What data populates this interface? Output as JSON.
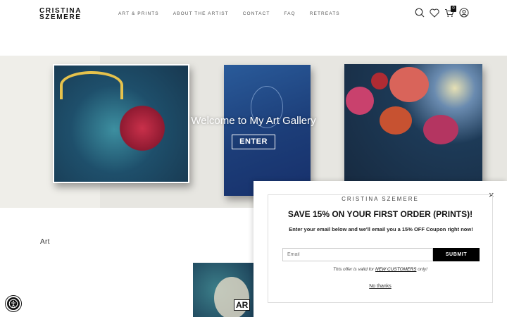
{
  "header": {
    "logo_line1": "CRISTINA",
    "logo_line2": "SZEMERE",
    "nav": [
      "ART & PRINTS",
      "ABOUT THE ARTIST",
      "CONTACT",
      "FAQ",
      "RETREATS"
    ],
    "cart_count": "0",
    "icons": [
      "search-icon",
      "heart-icon",
      "cart-icon",
      "user-icon"
    ]
  },
  "hero": {
    "title": "Welcome to My Art Gallery",
    "button_label": "ENTER"
  },
  "section": {
    "title": "Art",
    "thumb_badge": "AR"
  },
  "popup": {
    "brand": "CRISTINA SZEMERE",
    "headline": "SAVE 15% ON YOUR FIRST ORDER (PRINTS)!",
    "subtext": "Enter your email below and we'll email you a 15% OFF Coupon right now!",
    "email_placeholder": "Email",
    "submit_label": "SUBMIT",
    "offer_prefix": "This offer is valid for ",
    "offer_link": "NEW CUSTOMERS",
    "offer_suffix": " only!",
    "no_thanks": "No thanks",
    "close_symbol": "×"
  },
  "accessibility": {
    "icon": "accessibility-icon"
  }
}
